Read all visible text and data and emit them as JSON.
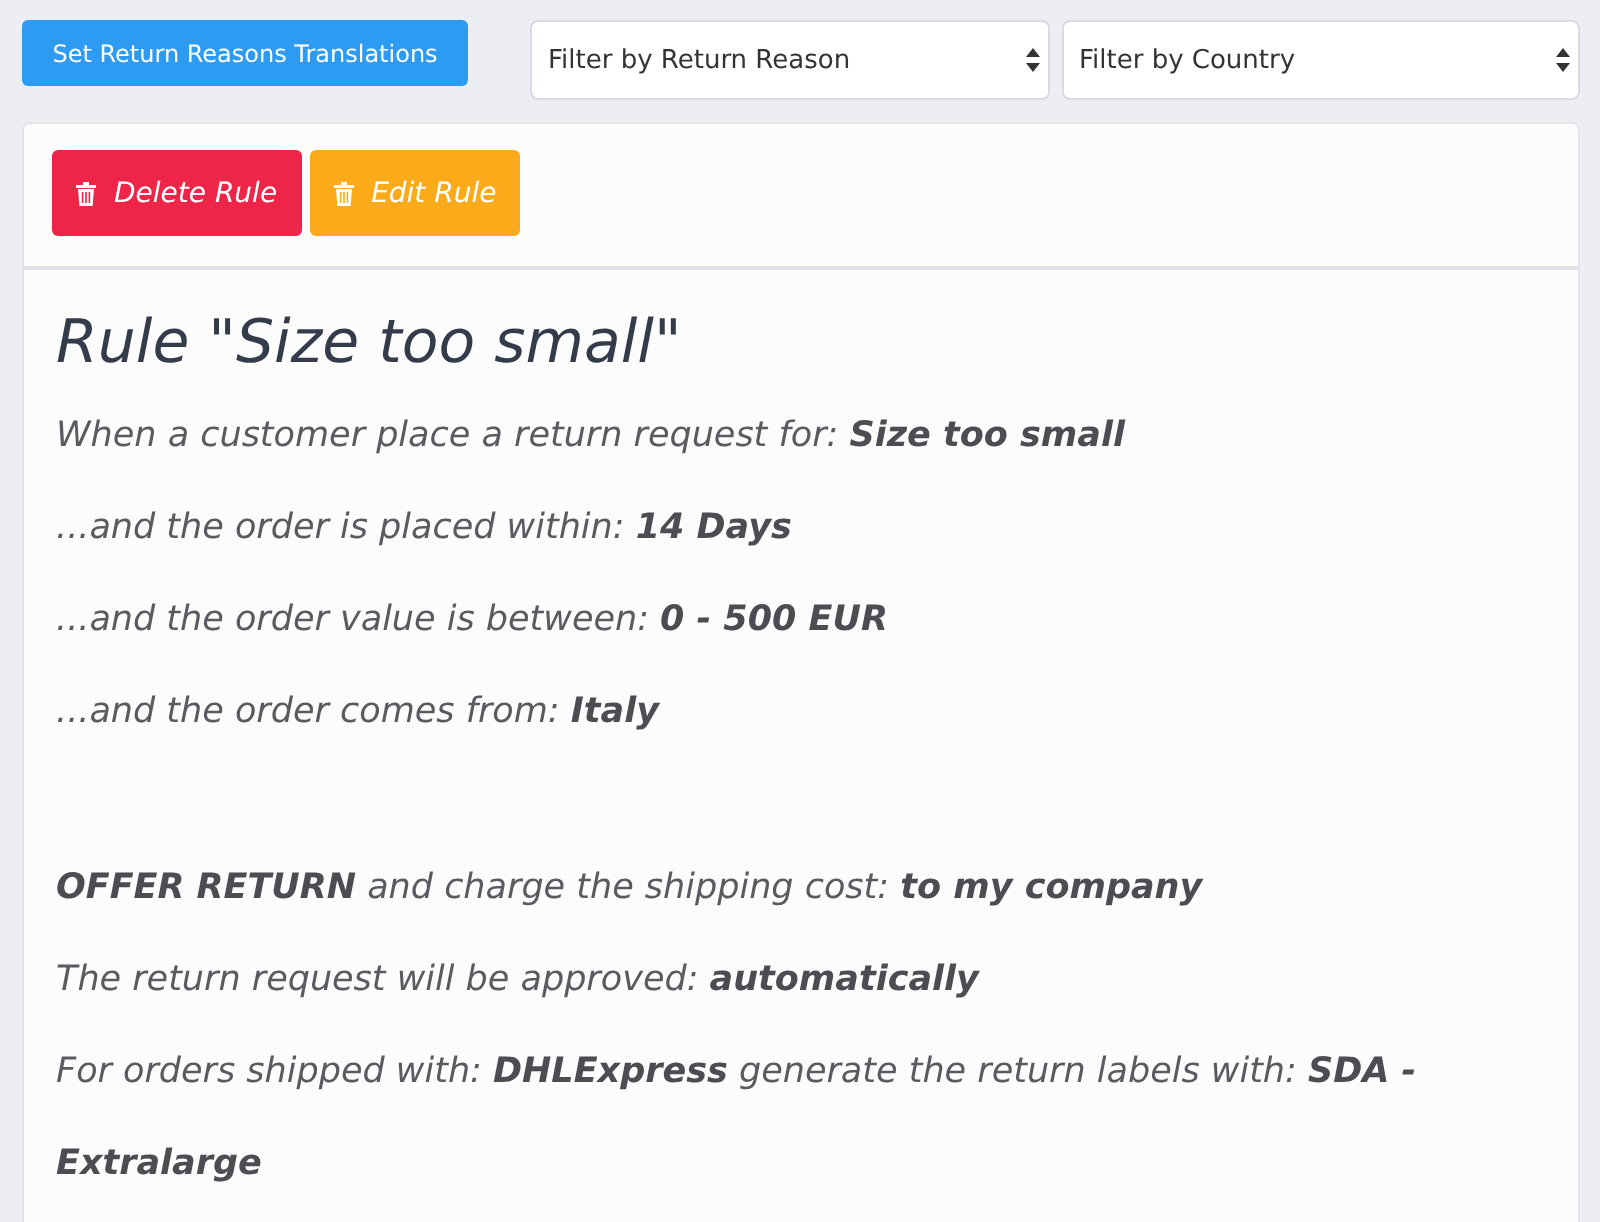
{
  "toolbar": {
    "translations_button": "Set Return Reasons Translations",
    "filters": [
      {
        "value": "Filter by Return Reason"
      },
      {
        "value": "Filter by Country"
      }
    ]
  },
  "rule_card": {
    "actions": [
      {
        "kind": "delete",
        "label": "Delete Rule"
      },
      {
        "kind": "edit",
        "label": "Edit Rule"
      }
    ],
    "title": "Rule \"Size too small\"",
    "conditions": [
      "When a customer place a return request for: **Size too small**",
      "...and the order is placed within: **14 Days**",
      "...and the order value is between: **0 - 500 EUR**",
      "...and the order comes from: **Italy**"
    ],
    "outcomes": [
      "**OFFER RETURN** and charge the shipping cost: **to my company**",
      "The return request will be approved: **automatically**",
      "For orders shipped with: **DHLExpress** generate the return labels with: **SDA - Extralarge**"
    ]
  }
}
